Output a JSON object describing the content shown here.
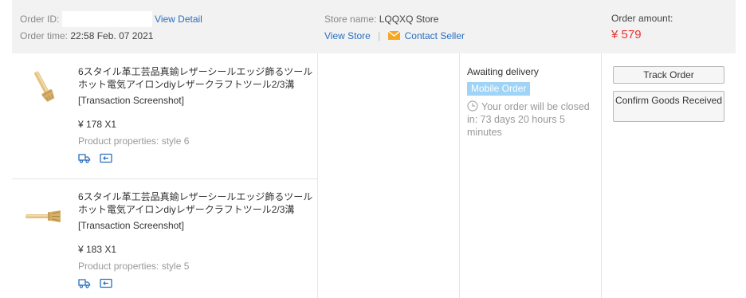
{
  "header": {
    "order_id_label": "Order ID:",
    "view_detail": "View Detail",
    "order_time_label": "Order time:",
    "order_time_value": "22:58 Feb. 07 2021",
    "store_name_label": "Store name:",
    "store_name_value": "LQQXQ Store",
    "view_store": "View Store",
    "separator": "|",
    "contact_seller": "Contact Seller",
    "order_amount_label": "Order amount:",
    "order_amount_value": "¥ 579"
  },
  "products": [
    {
      "title": "6スタイル革工芸品真鍮レザーシールエッジ飾るツールホット電気アイロンdiyレザークラフトツール2/3溝",
      "snapshot": "[Transaction Screenshot]",
      "price": "¥ 178 X1",
      "properties": "Product properties: style 6"
    },
    {
      "title": "6スタイル革工芸品真鍮レザーシールエッジ飾るツールホット電気アイロンdiyレザークラフトツール2/3溝",
      "snapshot": "[Transaction Screenshot]",
      "price": "¥ 183 X1",
      "properties": "Product properties: style 5"
    }
  ],
  "status": {
    "text": "Awaiting delivery",
    "badge": "Mobile Order",
    "countdown": "Your order will be closed in: 73 days 20 hours 5 minutes"
  },
  "actions": {
    "track": "Track Order",
    "confirm": "Confirm Goods Received"
  },
  "colors": {
    "header_bg": "#f2f2f2",
    "link": "#2a6ebf",
    "amount": "#e5352f",
    "badge_bg": "#9fd4f7",
    "icon": "#2a6ebf"
  }
}
